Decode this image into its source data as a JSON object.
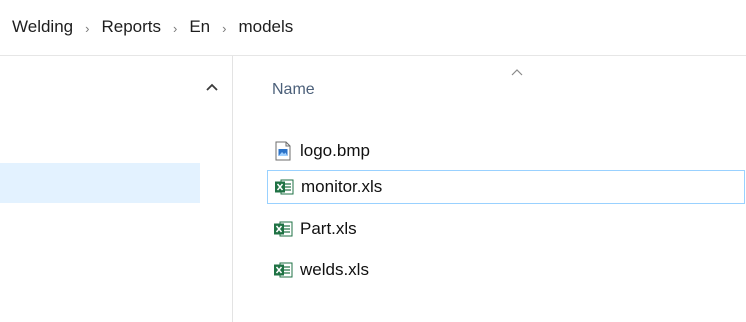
{
  "breadcrumb": {
    "items": [
      "Welding",
      "Reports",
      "En",
      "models"
    ],
    "separator": "›"
  },
  "file_list": {
    "column_header": "Name",
    "sort_direction": "ascending",
    "files": [
      {
        "name": "logo.bmp",
        "icon": "bitmap-image-icon"
      },
      {
        "name": "monitor.xls",
        "icon": "excel-file-icon",
        "selected": true
      },
      {
        "name": "Part.xls",
        "icon": "excel-file-icon"
      },
      {
        "name": "welds.xls",
        "icon": "excel-file-icon"
      }
    ]
  },
  "colors": {
    "selection_fill": "#cce8ff",
    "selection_border": "#99d1ff",
    "header_text": "#4c607a",
    "excel_green": "#1f7244"
  }
}
